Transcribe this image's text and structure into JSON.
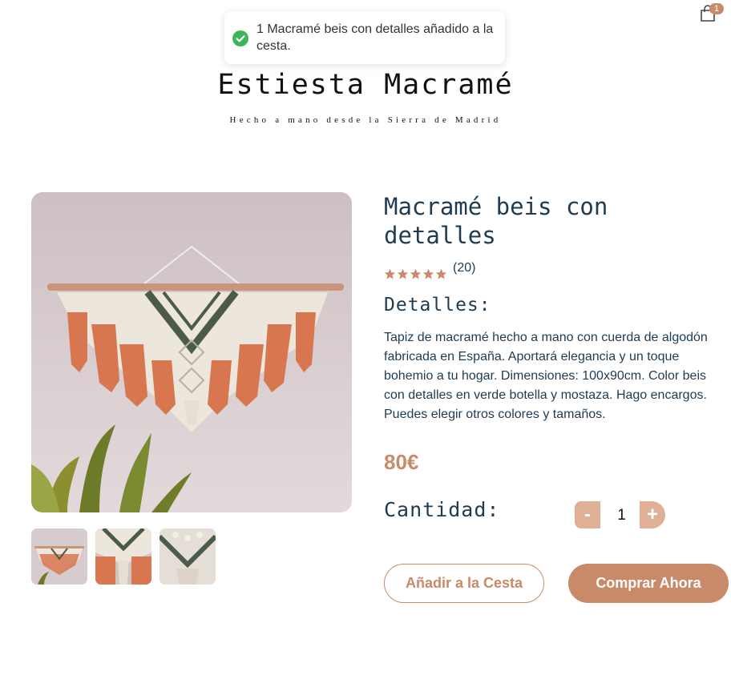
{
  "header": {
    "cart_icon": "shopping-bag-icon",
    "cart_count": "1"
  },
  "toast": {
    "icon": "check-circle-icon",
    "message": "1 Macramé beis con detalles añadido a la cesta.",
    "success_color": "#3cb55a"
  },
  "brand": {
    "title": "Estiesta Macramé",
    "tagline": "Hecho a mano desde la Sierra de Madrid"
  },
  "product": {
    "title": "Macramé beis con detalles",
    "rating": 5,
    "rating_max": 5,
    "rating_count": "(20)",
    "details_heading": "Detalles:",
    "description": "Tapiz de macramé hecho a mano con cuerda de algodón fabricada en España. Aportará elegancia y un toque bohemio a tu hogar. Dimensiones: 100x90cm. Color beis con detalles en verde botella y mostaza. Hago encargos. Puedes elegir otros colores y tamaños.",
    "price": "80€",
    "quantity_label": "Cantidad:",
    "quantity": "1",
    "minus_label": "-",
    "plus_label": "+",
    "add_to_cart_label": "Añadir a la Cesta",
    "buy_now_label": "Comprar Ahora",
    "images": {
      "main": "macrame-wall-hanging-image",
      "thumbnails": [
        "thumbnail-1",
        "thumbnail-2",
        "thumbnail-3"
      ]
    }
  },
  "colors": {
    "accent": "#c98a69",
    "accent_light": "#e0b096",
    "text_dark": "#1f3b52"
  }
}
